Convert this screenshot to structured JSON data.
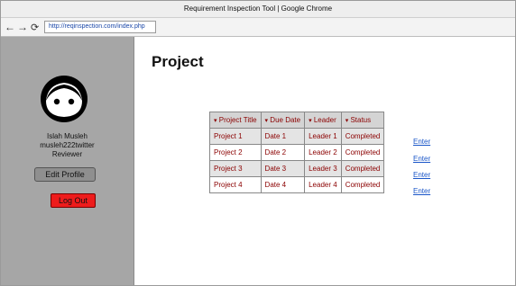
{
  "window": {
    "title": "Requirement Inspection Tool | Google Chrome"
  },
  "browser": {
    "url": "http://reqinspection.com/index.php",
    "back_icon": "←",
    "forward_icon": "→",
    "reload_icon": "⟳"
  },
  "user": {
    "name": "Islah Musleh",
    "handle": "musleh222twitter",
    "role": "Reviewer"
  },
  "buttons": {
    "edit_profile": "Edit Profile",
    "log_out": "Log Out"
  },
  "page": {
    "title": "Project"
  },
  "table": {
    "arrow": "▾",
    "headers": [
      "Project Title",
      "Due Date",
      "Leader",
      "Status"
    ],
    "rows": [
      [
        "Project 1",
        "Date 1",
        "Leader 1",
        "Completed"
      ],
      [
        "Project 2",
        "Date 2",
        "Leader 2",
        "Completed"
      ],
      [
        "Project 3",
        "Date 3",
        "Leader 3",
        "Completed"
      ],
      [
        "Project 4",
        "Date 4",
        "Leader 4",
        "Completed"
      ]
    ]
  },
  "enter_links": [
    "Enter",
    "Enter",
    "Enter",
    "Enter"
  ],
  "colors": {
    "sidebar": "#a6a6a6",
    "logout": "#ee1c1c",
    "table_text": "#8b0000",
    "link": "#1a56c8"
  }
}
